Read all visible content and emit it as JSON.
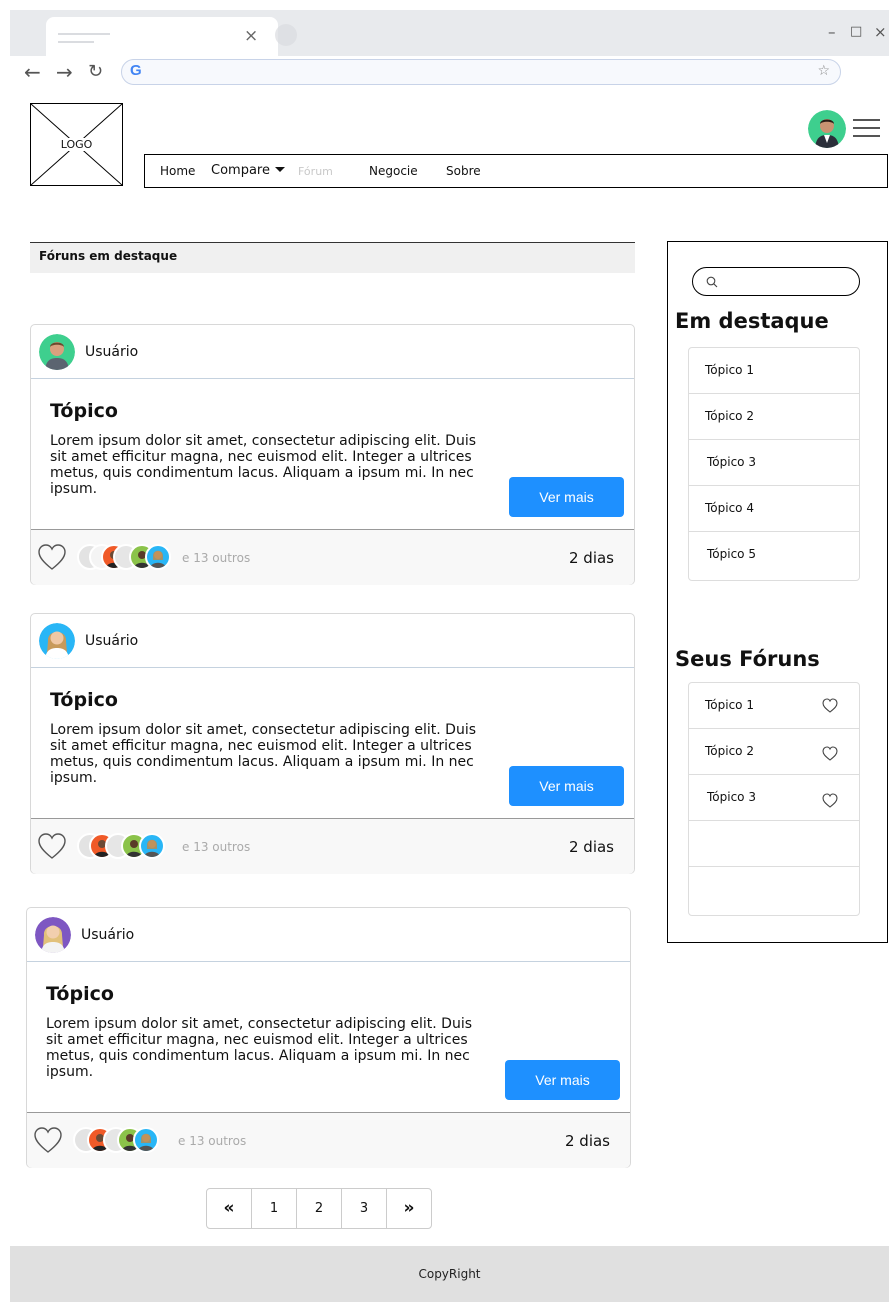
{
  "browser": {
    "tab_close_glyph": "×",
    "window_minimize": "–",
    "window_restore": "□",
    "window_close": "×",
    "back": "←",
    "forward": "→",
    "reload": "↻",
    "google_glyph": "G",
    "star_glyph": "☆",
    "menu_glyph": "⋮"
  },
  "header": {
    "logo_text": "LOGO",
    "nav": {
      "home": "Home",
      "compare": "Compare",
      "forum": "Fórum",
      "negocie": "Negocie",
      "sobre": "Sobre"
    }
  },
  "featured": {
    "heading": "Fóruns em destaque"
  },
  "posts": [
    {
      "user": "Usuário",
      "title": "Tópico",
      "text": "Lorem ipsum dolor sit amet, consectetur adipiscing elit. Duis sit amet efficitur magna, nec euismod elit. Integer a ultrices metus, quis condimentum lacus. Aliquam a ipsum mi. In nec ipsum.",
      "button": "Ver mais",
      "others": "e 13 outros",
      "age": "2 dias",
      "avatar_bg": "#3ecf8e"
    },
    {
      "user": "Usuário",
      "title": "Tópico",
      "text": "Lorem ipsum dolor sit amet, consectetur adipiscing elit. Duis sit amet efficitur magna, nec euismod elit. Integer a ultrices metus, quis condimentum lacus. Aliquam a ipsum mi. In nec ipsum.",
      "button": "Ver mais",
      "others": "e 13 outros",
      "age": "2 dias",
      "avatar_bg": "#29b6f6"
    },
    {
      "user": "Usuário",
      "title": "Tópico",
      "text": "Lorem ipsum dolor sit amet, consectetur adipiscing elit. Duis sit amet efficitur magna, nec euismod elit. Integer a ultrices metus, quis condimentum lacus. Aliquam a ipsum mi. In nec ipsum.",
      "button": "Ver mais",
      "others": "e 13 outros",
      "age": "2 dias",
      "avatar_bg": "#7e57c2"
    }
  ],
  "sidebar": {
    "search_placeholder": "",
    "featured_title": "Em destaque",
    "featured_topics": [
      "Tópico 1",
      "Tópico 2",
      "Tópico 3",
      "Tópico 4",
      "Tópico 5"
    ],
    "my_forums_title": "Seus Fóruns",
    "my_forums": [
      "Tópico 1",
      "Tópico 2",
      "Tópico 3",
      "",
      ""
    ]
  },
  "pagination": {
    "first": "«",
    "pages": [
      "1",
      "2",
      "3"
    ],
    "last": "»"
  },
  "footer": {
    "text": "CopyRight"
  },
  "colors": {
    "button": "#1e90ff",
    "user_avatar": "#3ecf8e"
  }
}
